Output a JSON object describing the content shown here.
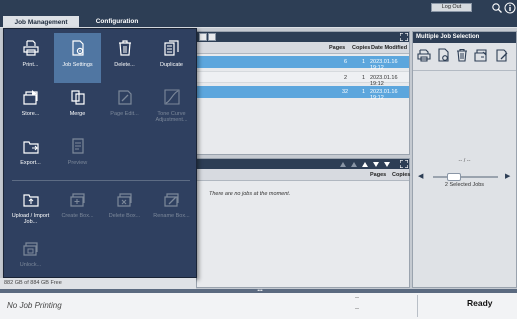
{
  "tabs": {
    "job_management": "Job Management",
    "configuration": "Configuration"
  },
  "header": {
    "logout_label": "Log Out"
  },
  "popup_menu": {
    "items": [
      {
        "label": "Print...",
        "icon": "print-icon",
        "enabled": true
      },
      {
        "label": "Job Settings",
        "icon": "job-settings-icon",
        "enabled": true,
        "active": true
      },
      {
        "label": "Delete...",
        "icon": "trash-icon",
        "enabled": true
      },
      {
        "label": "Duplicate",
        "icon": "duplicate-icon",
        "enabled": true
      },
      {
        "label": "Store...",
        "icon": "store-icon",
        "enabled": true
      },
      {
        "label": "Merge",
        "icon": "merge-icon",
        "enabled": true
      },
      {
        "label": "Page Edit...",
        "icon": "page-edit-icon",
        "enabled": false
      },
      {
        "label": "Tone Curve Adjustment...",
        "icon": "tone-curve-icon",
        "enabled": false
      },
      {
        "label": "Export...",
        "icon": "export-icon",
        "enabled": true
      },
      {
        "label": "Preview",
        "icon": "preview-icon",
        "enabled": false
      },
      {
        "label": "Upload / Import Job...",
        "icon": "upload-icon",
        "enabled": true
      },
      {
        "label": "Create Box...",
        "icon": "create-box-icon",
        "enabled": false
      },
      {
        "label": "Delete Box...",
        "icon": "delete-box-icon",
        "enabled": false
      },
      {
        "label": "Rename Box...",
        "icon": "rename-box-icon",
        "enabled": false
      },
      {
        "label": "Unlock...",
        "icon": "unlock-icon",
        "enabled": false
      }
    ]
  },
  "job_list": {
    "columns": {
      "pages": "Pages",
      "copies": "Copies",
      "date_modified": "Date Modified"
    },
    "rows": [
      {
        "pages": "6",
        "copies": "1",
        "date": "2023.01.16 19:12",
        "selected": true
      },
      {
        "pages": "2",
        "copies": "1",
        "date": "2023.01.16 19:12",
        "selected": false
      },
      {
        "pages": "32",
        "copies": "1",
        "date": "2023.01.16 19:12",
        "selected": true
      }
    ]
  },
  "lower_list": {
    "columns": {
      "pages": "Pages",
      "copies": "Copies"
    },
    "empty_message": "There are no jobs at the moment."
  },
  "multiple_selection": {
    "title": "Multiple Job Selection",
    "page_indicator": "-- / --",
    "selected_text": "2 Selected Jobs"
  },
  "storage": {
    "free_text": "882 GB of 884 GB Free"
  },
  "status": {
    "printing": "No Job Printing",
    "dash1": "--",
    "dash2": "--",
    "state": "Ready",
    "handle": "•••"
  },
  "colors": {
    "accent": "#5ca6dd",
    "menu_bg": "#2f4060",
    "topbar": "#2d3e55"
  }
}
